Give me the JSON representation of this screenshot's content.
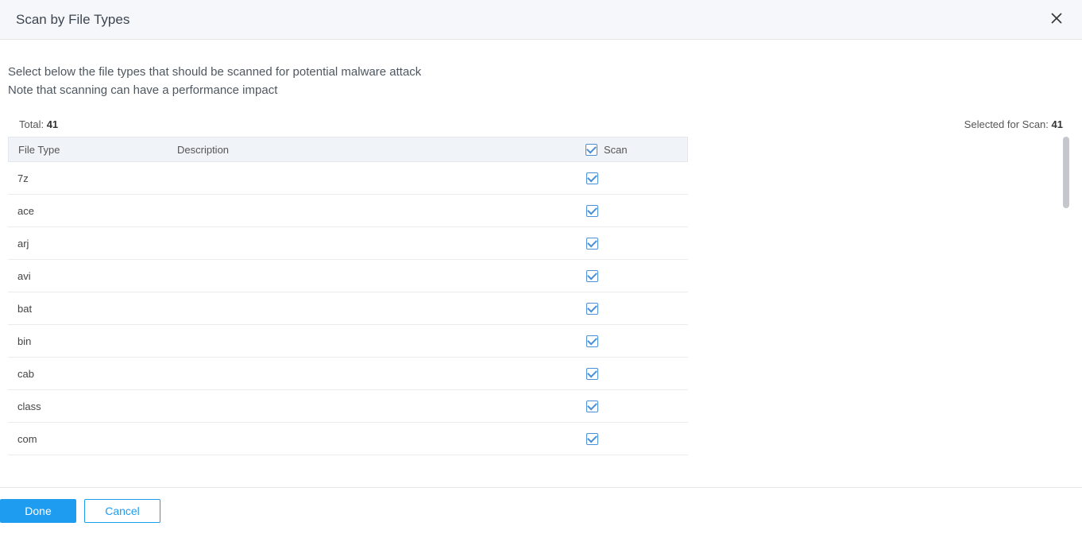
{
  "header": {
    "title": "Scan by File Types"
  },
  "intro": {
    "line1": "Select below the file types that should be scanned for potential malware attack",
    "line2": "Note that scanning can have a performance impact"
  },
  "counts": {
    "total_label": "Total:",
    "total_value": "41",
    "selected_label": "Selected for Scan:",
    "selected_value": "41"
  },
  "columns": {
    "file_type": "File Type",
    "description": "Description",
    "scan": "Scan"
  },
  "rows": [
    {
      "type": "7z",
      "description": "",
      "checked": true
    },
    {
      "type": "ace",
      "description": "",
      "checked": true
    },
    {
      "type": "arj",
      "description": "",
      "checked": true
    },
    {
      "type": "avi",
      "description": "",
      "checked": true
    },
    {
      "type": "bat",
      "description": "",
      "checked": true
    },
    {
      "type": "bin",
      "description": "",
      "checked": true
    },
    {
      "type": "cab",
      "description": "",
      "checked": true
    },
    {
      "type": "class",
      "description": "",
      "checked": true
    },
    {
      "type": "com",
      "description": "",
      "checked": true
    }
  ],
  "header_checked": true,
  "footer": {
    "done": "Done",
    "cancel": "Cancel"
  }
}
